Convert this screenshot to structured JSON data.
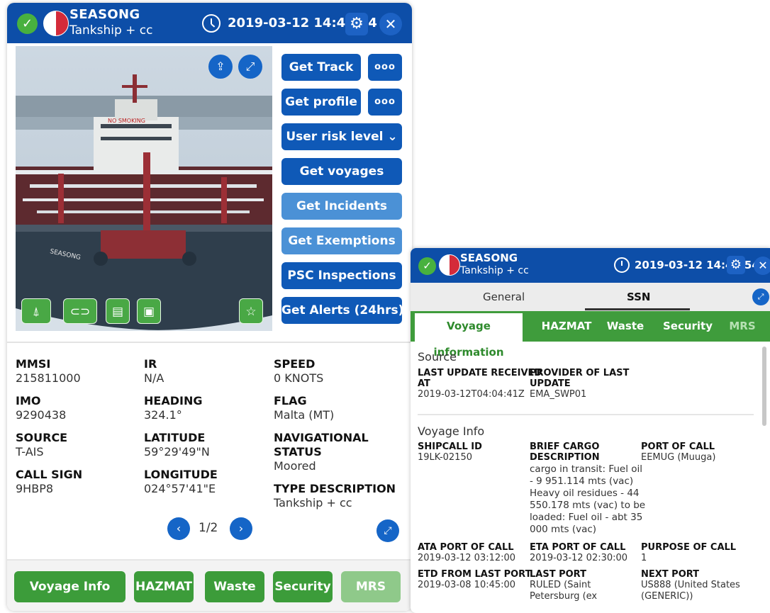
{
  "vessel": {
    "name": "SEASONG",
    "type": "Tankship + cc",
    "timestamp": "2019-03-12 14:42:54"
  },
  "photo": {
    "hull_text": "SEASONG",
    "deck_text": "NO SMOKING"
  },
  "actions": {
    "get_track": "Get Track",
    "get_profile": "Get profile",
    "more": "ooo",
    "risk_level": "User risk level",
    "get_voyages": "Get voyages",
    "get_incidents": "Get Incidents",
    "get_exemptions": "Get Exemptions",
    "psc_inspections": "PSC Inspections",
    "get_alerts": "Get Alerts (24hrs)"
  },
  "details": {
    "mmsi_label": "MMSI",
    "mmsi": "215811000",
    "imo_label": "IMO",
    "imo": "9290438",
    "source_label": "SOURCE",
    "source": "T-AIS",
    "callsign_label": "CALL SIGN",
    "callsign": "9HBP8",
    "ir_label": "IR",
    "ir": "N/A",
    "heading_label": "HEADING",
    "heading": "324.1°",
    "latitude_label": "LATITUDE",
    "latitude": "59°29'49\"N",
    "longitude_label": "LONGITUDE",
    "longitude": "024°57'41\"E",
    "speed_label": "SPEED",
    "speed": "0 KNOTS",
    "flag_label": "FLAG",
    "flag": "Malta (MT)",
    "navstatus_label_1": "NAVIGATIONAL",
    "navstatus_label_2": "STATUS",
    "navstatus": "Moored",
    "typedesc_label": "TYPE DESCRIPTION",
    "typedesc": "Tankship + cc"
  },
  "pager": {
    "text": "1/2"
  },
  "footer": {
    "voyage_info": "Voyage Info",
    "hazmat": "HAZMAT",
    "waste": "Waste",
    "security": "Security",
    "mrs": "MRS"
  },
  "right": {
    "tabs": {
      "general": "General",
      "ssn": "SSN"
    },
    "subtabs": {
      "voyage_information": "Voyage information",
      "hazmat": "HAZMAT",
      "waste": "Waste",
      "security": "Security",
      "mrs": "MRS"
    },
    "source_title": "Source",
    "last_update_label_1": "LAST UPDATE RECEIVED",
    "last_update_label_2": "AT",
    "last_update": "2019-03-12T04:04:41Z",
    "provider_label_1": "PROVIDER OF LAST",
    "provider_label_2": "UPDATE",
    "provider": "EMA_SWP01",
    "voyage_title": "Voyage Info",
    "shipcall_label": "SHIPCALL ID",
    "shipcall": "19LK-02150",
    "cargo_label_1": "BRIEF CARGO",
    "cargo_label_2": "DESCRIPTION",
    "cargo_lines": [
      "cargo in transit: Fuel oil",
      "- 9 951.114 mts (vac)",
      "Heavy oil residues - 44",
      "550.178 mts (vac) to be",
      "loaded: Fuel oil - abt 35",
      "000 mts (vac)"
    ],
    "port_of_call_label": "PORT OF CALL",
    "port_of_call": "EEMUG (Muuga)",
    "ata_label": "ATA PORT OF CALL",
    "ata": "2019-03-12 03:12:00",
    "eta_label": "ETA PORT OF CALL",
    "eta": "2019-03-12 02:30:00",
    "purpose_label": "PURPOSE OF CALL",
    "purpose": "1",
    "etd_label": "ETD FROM LAST PORT",
    "etd": "2019-03-08 10:45:00",
    "last_port_label": "LAST PORT",
    "last_port_1": "RULED (Saint",
    "last_port_2": "Petersburg (ex",
    "next_port_label": "NEXT PORT",
    "next_port_1": "US888 (United States",
    "next_port_2": "(GENERIC))"
  },
  "colors": {
    "header_blue": "#0d4ea8",
    "button_blue": "#0f59b7",
    "button_light_blue": "#4b91d6",
    "green": "#3f9c3c",
    "status_green": "#48b13f"
  },
  "icons": [
    "check-icon",
    "malta-flag-icon",
    "clock-icon",
    "gear-icon",
    "close-icon",
    "share-icon",
    "expand-icon",
    "chevron-down-icon",
    "chevron-left-icon",
    "chevron-right-icon",
    "star-icon",
    "link-icon",
    "document-icon",
    "anchor-icon",
    "navigation-icon"
  ]
}
